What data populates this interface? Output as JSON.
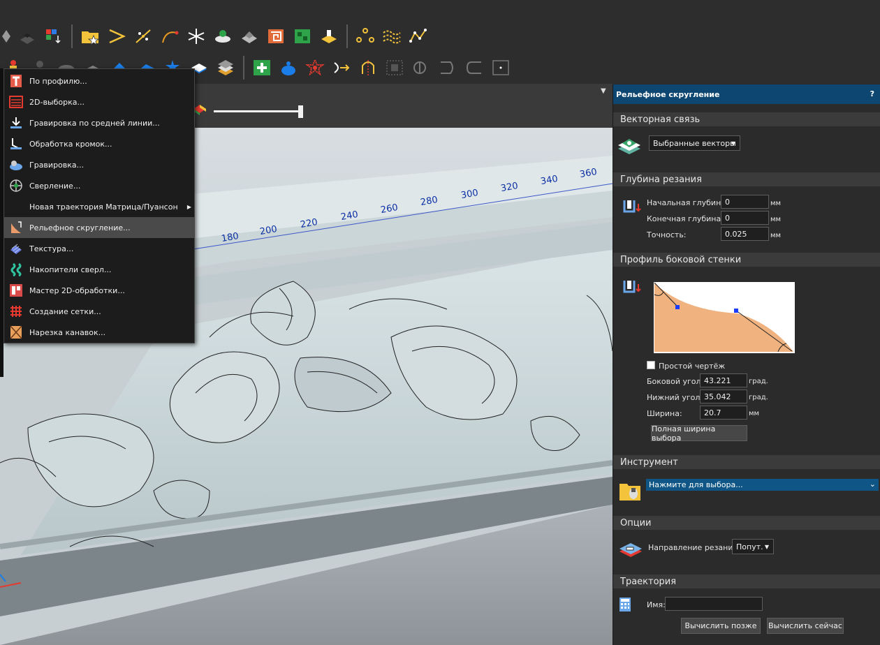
{
  "toolbar": {
    "row1_icons": [
      "box-shape-icon",
      "sheet-icon",
      "color-grid-icon",
      "folder-star-icon",
      "vector-arrow-icon",
      "scatter-icon",
      "curve-icon",
      "star-burst-icon",
      "layer-stack-icon",
      "relief-icon",
      "spiral-icon",
      "green-block-icon",
      "gold-lift-icon",
      "node-circle-icon",
      "wave-line-icon",
      "polyline-icon"
    ],
    "row2_icons": [
      "candle-icon",
      "pawn-icon",
      "dome-icon",
      "flat-icon",
      "blue-wave-icon",
      "blue-star-icon",
      "cube-icon",
      "layer-cake-icon",
      "plus-square-icon",
      "blue-bowl-icon",
      "burst-icon",
      "arrow-curve-icon",
      "arch-icon",
      "dotted-square-icon",
      "fillet-icon",
      "bracket-icon",
      "rounded-bracket-icon",
      "dot-square-icon"
    ]
  },
  "menu": {
    "items": [
      {
        "label": "По профилю...",
        "icon": "profile-t-icon",
        "active": false,
        "submenu": false
      },
      {
        "label": "2D-выборка...",
        "icon": "pocket-icon",
        "active": false,
        "submenu": false
      },
      {
        "label": "Гравировка по средней линии...",
        "icon": "centerline-icon",
        "active": false,
        "submenu": false
      },
      {
        "label": "Обработка кромок...",
        "icon": "edge-icon",
        "active": false,
        "submenu": false
      },
      {
        "label": "Гравировка...",
        "icon": "engrave-icon",
        "active": false,
        "submenu": false
      },
      {
        "label": "Сверление...",
        "icon": "drill-icon",
        "active": false,
        "submenu": false
      },
      {
        "label": "Новая траектория Матрица/Пуансон",
        "icon": "",
        "active": false,
        "submenu": true
      },
      {
        "label": "Рельефное скругление...",
        "icon": "relief-fillet-icon",
        "active": true,
        "submenu": false
      },
      {
        "label": "Текстура...",
        "icon": "texture-icon",
        "active": false,
        "submenu": false
      },
      {
        "label": "Накопители сверл...",
        "icon": "drill-bank-icon",
        "active": false,
        "submenu": false
      },
      {
        "label": "Мастер  2D-обработки...",
        "icon": "wizard-icon",
        "active": false,
        "submenu": false
      },
      {
        "label": "Создание сетки...",
        "icon": "grid-icon",
        "active": false,
        "submenu": false
      },
      {
        "label": "Нарезка канавок...",
        "icon": "groove-icon",
        "active": false,
        "submenu": false
      }
    ]
  },
  "ruler": {
    "labels": [
      "180",
      "200",
      "220",
      "240",
      "260",
      "280",
      "300",
      "320",
      "340",
      "360"
    ]
  },
  "panel": {
    "title": "Рельефное скругление",
    "help": "?",
    "vector_link": {
      "heading": "Векторная связь",
      "selection": "Выбранные векторы"
    },
    "cut_depth": {
      "heading": "Глубина резания",
      "start_label": "Начальная глубина:",
      "start_value": "0",
      "end_label": "Конечная глубина:",
      "end_value": "0",
      "tol_label": "Точность:",
      "tol_value": "0.025",
      "unit": "мм"
    },
    "side_profile": {
      "heading": "Профиль боковой стенки",
      "simple_label": "Простой чертёж",
      "simple_checked": false,
      "side_angle_label": "Боковой угол:",
      "side_angle_value": "43.221",
      "bottom_angle_label": "Нижний угол:",
      "bottom_angle_value": "35.042",
      "width_label": "Ширина:",
      "width_value": "20.7",
      "deg_unit": "град.",
      "mm_unit": "мм",
      "full_width_button": "Полная ширина выбора",
      "profile_fill": "#f0b27e"
    },
    "tool": {
      "heading": "Инструмент",
      "placeholder": "Нажмите для выбора..."
    },
    "options": {
      "heading": "Опции",
      "direction_label": "Направление резания:",
      "direction_value": "Попут."
    },
    "toolpath": {
      "heading": "Траектория",
      "name_label": "Имя:",
      "name_value": "",
      "later_button": "Вычислить позже",
      "now_button": "Вычислить сейчас"
    }
  },
  "colors": {
    "accent": "#0d4670",
    "selection": "#0f5687",
    "menu_bg": "#1c1c1c"
  }
}
